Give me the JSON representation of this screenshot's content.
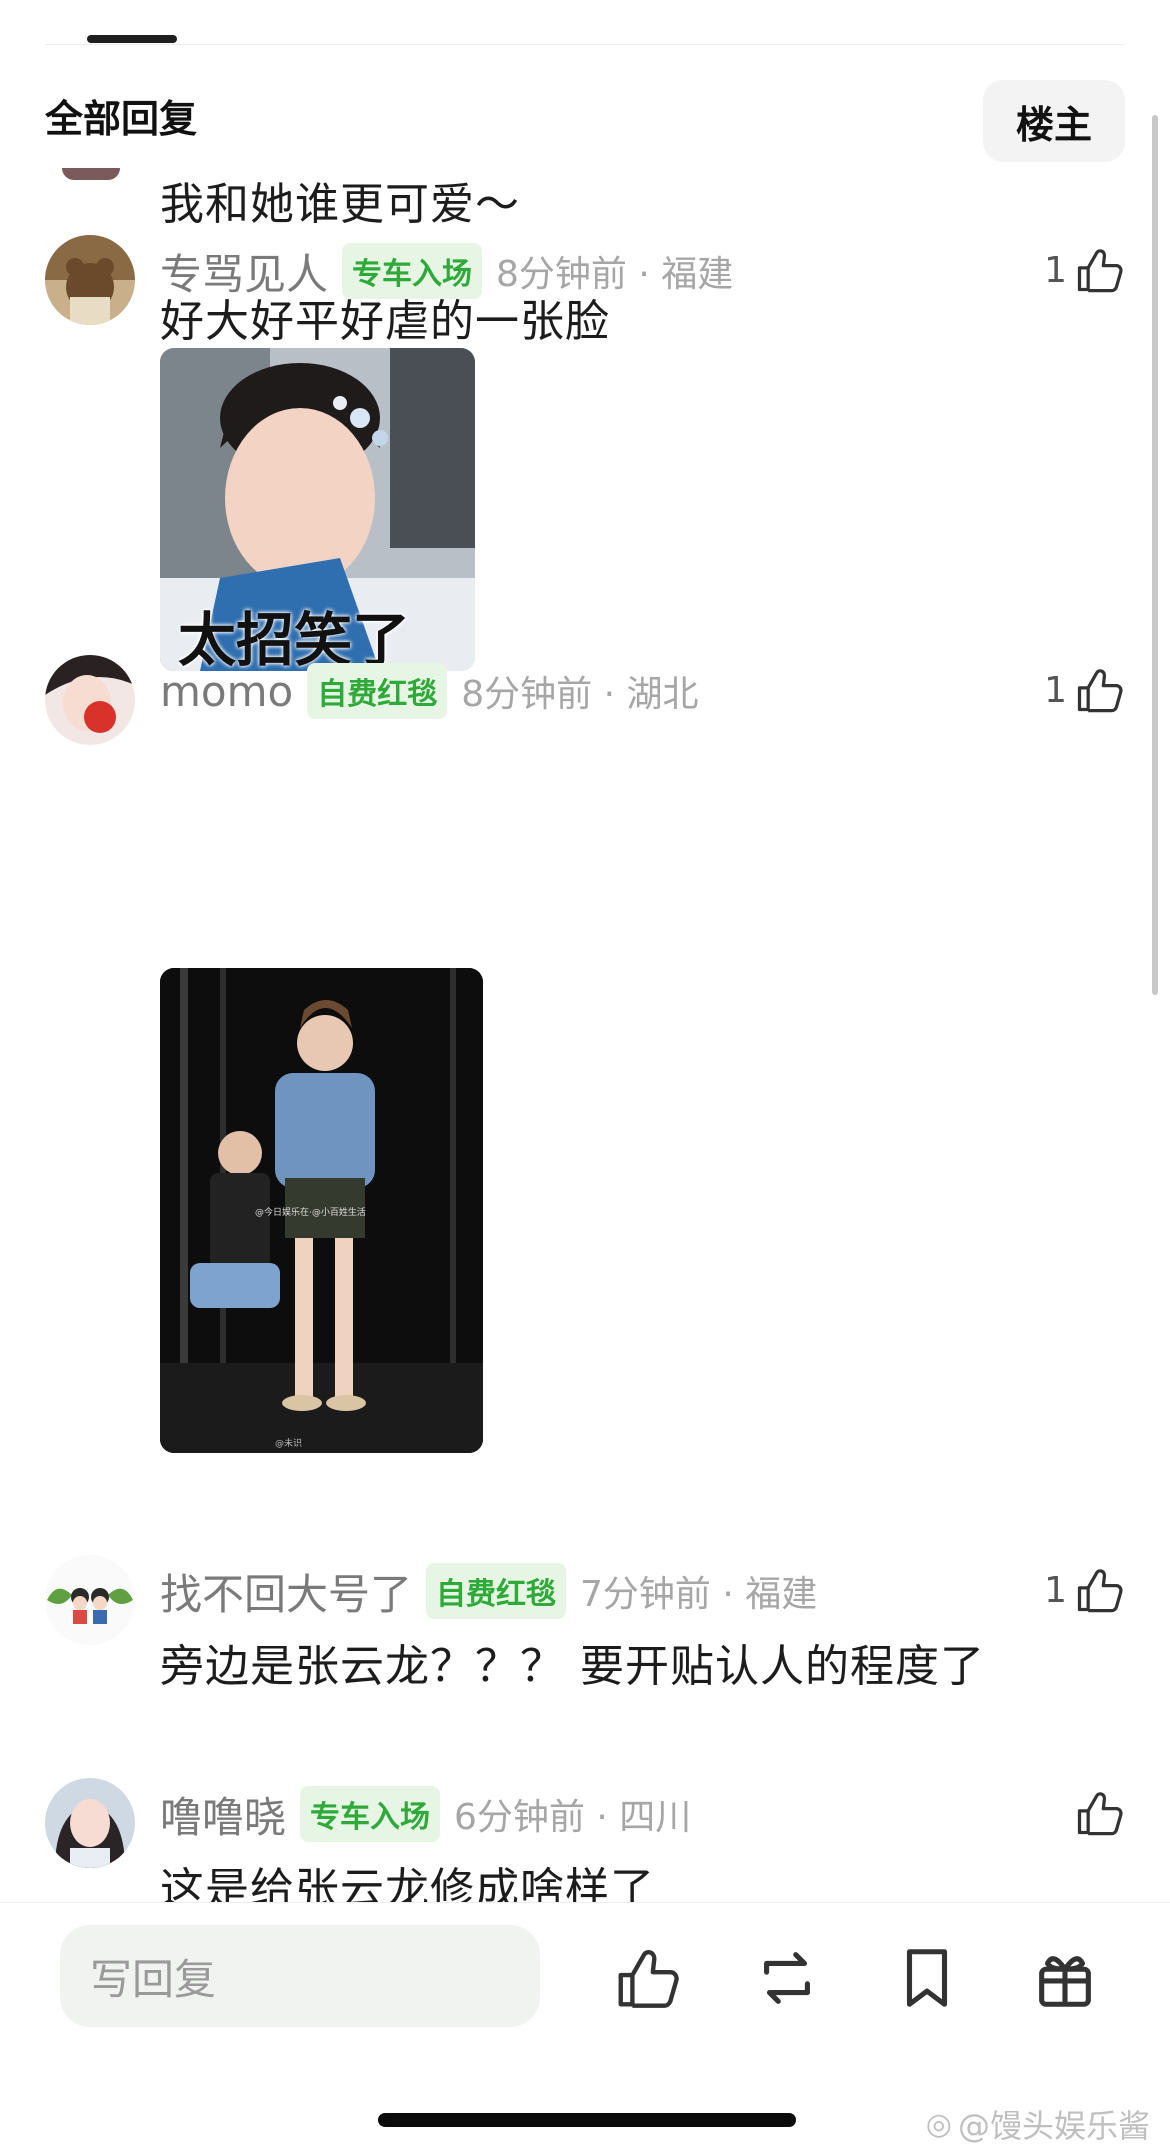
{
  "header": {
    "title": "全部回复",
    "op_button": "楼主"
  },
  "partial_comment": {
    "text": "我和她谁更可爱～"
  },
  "comments": [
    {
      "username": "专骂见人",
      "badge": "专车入场",
      "time": "8分钟前 · 福建",
      "likes": "1",
      "text": "好大好平好虐的一张脸",
      "image_caption": "太招笑了"
    },
    {
      "username": "momo",
      "badge": "自费红毯",
      "time": "8分钟前 · 湖北",
      "likes": "1",
      "watermark_text": "@今日娱乐在·@小百姓生活",
      "watermark_text2": "@未识"
    },
    {
      "username": "找不回大号了",
      "badge": "自费红毯",
      "time": "7分钟前 · 福建",
      "likes": "1",
      "text": "旁边是张云龙？？？ 要开贴认人的程度了"
    },
    {
      "username": "噜噜晓",
      "badge": "专车入场",
      "time": "6分钟前 · 四川",
      "likes": "",
      "text": "这是给张云龙修成啥样了"
    }
  ],
  "bottom_bar": {
    "reply_placeholder": "写回复",
    "actions": [
      "thumbs-up-icon",
      "repost-icon",
      "bookmark-icon",
      "gift-icon"
    ]
  },
  "watermark": {
    "text": "@馒头娱乐酱"
  },
  "colors": {
    "badge_green": "#2faa3a",
    "badge_bg": "#e7f6e4",
    "meta_gray": "#a6a6a6"
  }
}
